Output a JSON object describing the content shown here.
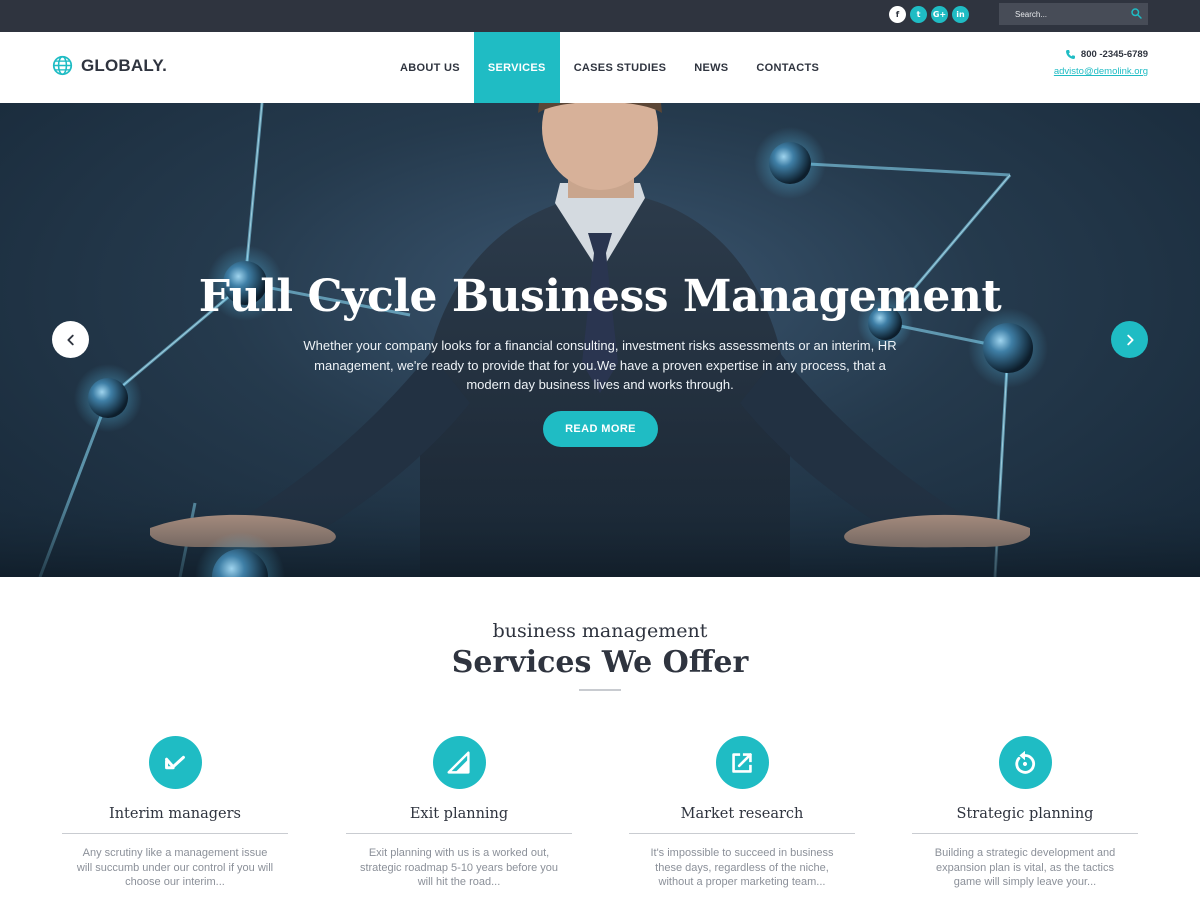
{
  "topbar": {
    "socials": [
      {
        "label": "f",
        "icon": "facebook-icon"
      },
      {
        "label": "t",
        "icon": "twitter-icon"
      },
      {
        "label": "G+",
        "icon": "google-plus-icon"
      },
      {
        "label": "in",
        "icon": "linkedin-icon"
      }
    ],
    "search_placeholder": "Search..."
  },
  "header": {
    "logo": "GLOBALY.",
    "nav": [
      "ABOUT US",
      "SERVICES",
      "CASES STUDIES",
      "NEWS",
      "CONTACTS"
    ],
    "active_nav": "SERVICES",
    "phone": "800 -2345-6789",
    "email": "advisto@demolink.org"
  },
  "hero": {
    "title": "Full Cycle Business Management",
    "text": "Whether your company looks for a financial consulting, investment risks assessments or an interim, HR management, we're ready to provide that for you.We have a proven expertise in any process, that a modern day business lives and works through.",
    "button": "READ MORE"
  },
  "services": {
    "subtitle": "business management",
    "title": "Services We Offer",
    "items": [
      {
        "title": "Interim managers",
        "text": "Any scrutiny like a management issue will succumb under our control if you will choose our interim...",
        "icon": "check-arrow-icon"
      },
      {
        "title": "Exit planning",
        "text": "Exit planning with us is a worked out, strategic roadmap 5-10 years before you will hit the road...",
        "icon": "signal-triangle-icon"
      },
      {
        "title": "Market research",
        "text": "It's impossible to succeed in business these days, regardless of the niche, without a proper marketing team...",
        "icon": "external-link-icon"
      },
      {
        "title": "Strategic planning",
        "text": "Building a strategic development and expansion plan is vital, as the tactics game will simply leave your...",
        "icon": "refresh-icon"
      }
    ]
  },
  "colors": {
    "accent": "#1fbcc4",
    "topbar": "#2f343f",
    "text_dark": "#2f343f",
    "text_muted": "#8b9099"
  }
}
